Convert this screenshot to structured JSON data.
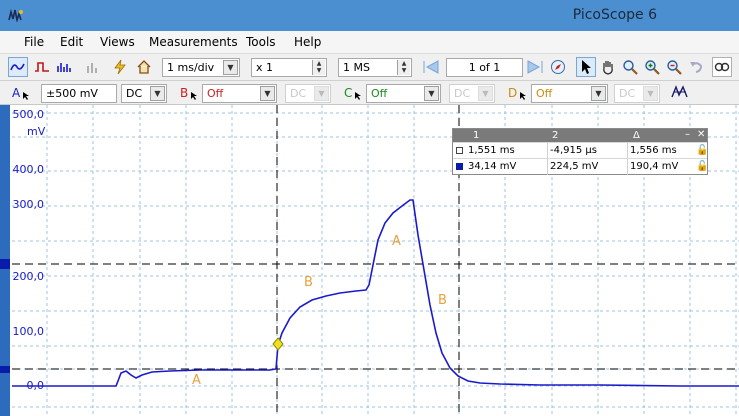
{
  "window": {
    "title": "PicoScope 6"
  },
  "menu": [
    {
      "label": "File"
    },
    {
      "label": "Edit"
    },
    {
      "label": "Views"
    },
    {
      "label": "Measurements"
    },
    {
      "label": "Tools"
    },
    {
      "label": "Help"
    }
  ],
  "toolbar": {
    "timebase": "1 ms/div",
    "zoom": "x 1",
    "samples": "1 MS",
    "page": "1 of 1"
  },
  "channels": [
    {
      "letter": "A",
      "range": "±500 mV",
      "coupling": "DC",
      "color": "#1a1acc"
    },
    {
      "letter": "B",
      "range": "Off",
      "coupling": "DC",
      "color": "#cc2020"
    },
    {
      "letter": "C",
      "range": "Off",
      "coupling": "DC",
      "color": "#1a8a1a"
    },
    {
      "letter": "D",
      "range": "Off",
      "coupling": "DC",
      "color": "#c88a10"
    }
  ],
  "scope": {
    "y_ticks": [
      "500,0",
      "400,0",
      "300,0",
      "200,0",
      "100,0",
      "0,0"
    ],
    "y_unit": "mV",
    "labels": [
      "A",
      "B",
      "A",
      "B"
    ],
    "colors": {
      "trace": "#1a1acc",
      "grid": "#9cc4e0",
      "label": "#e8a040",
      "strip": "#2d6bbd"
    }
  },
  "measurements": {
    "header": [
      "1",
      "2",
      "Δ"
    ],
    "rows": [
      {
        "c1": "1,551 ms",
        "c2": "-4,915 µs",
        "delta": "1,556 ms"
      },
      {
        "c1": "34,14 mV",
        "c2": "224,5 mV",
        "delta": "190,4 mV"
      }
    ]
  }
}
